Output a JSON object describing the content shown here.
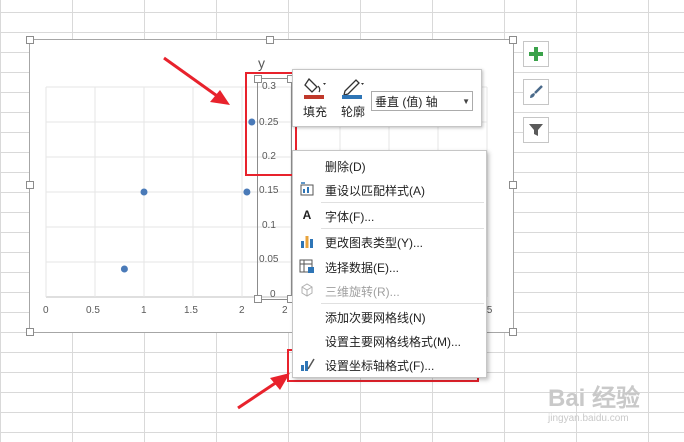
{
  "chart": {
    "title": "y",
    "x_ticks": [
      "0",
      "0.5",
      "1",
      "1.5",
      "2",
      "2",
      ".5"
    ],
    "y_ticks": [
      "0.3",
      "0.25",
      "0.2",
      "0.15",
      "0.1",
      "0.05",
      "0"
    ]
  },
  "chart_data": {
    "type": "scatter",
    "title": "y",
    "xlabel": "",
    "ylabel": "",
    "xlim": [
      0,
      4.5
    ],
    "ylim": [
      0,
      0.3
    ],
    "points": [
      {
        "x": 0.8,
        "y": 0.04
      },
      {
        "x": 1.0,
        "y": 0.15
      },
      {
        "x": 2.05,
        "y": 0.15
      },
      {
        "x": 2.1,
        "y": 0.25
      }
    ]
  },
  "mini_toolbar": {
    "fill_label": "填充",
    "outline_label": "轮廓",
    "element_select": "垂直 (值) 轴"
  },
  "context_menu": {
    "items": [
      {
        "label": "删除(D)",
        "disabled": false
      },
      {
        "label": "重设以匹配样式(A)",
        "disabled": false
      },
      {
        "label": "字体(F)...",
        "disabled": false
      },
      {
        "label": "更改图表类型(Y)...",
        "disabled": false
      },
      {
        "label": "选择数据(E)...",
        "disabled": false
      },
      {
        "label": "三维旋转(R)...",
        "disabled": true
      },
      {
        "label": "添加次要网格线(N)",
        "disabled": false
      },
      {
        "label": "设置主要网格线格式(M)...",
        "disabled": false
      },
      {
        "label": "设置坐标轴格式(F)...",
        "disabled": false
      }
    ]
  },
  "side_buttons": [
    "plus-icon",
    "brush-icon",
    "filter-icon"
  ],
  "colors": {
    "accent_red": "#e8222c",
    "point_blue": "#4a7ab8",
    "fill_red": "#c0392b",
    "outline_blue": "#2e75b6"
  },
  "watermark": {
    "text": "Bai 经验",
    "subtext": "jingyan.baidu.com"
  }
}
